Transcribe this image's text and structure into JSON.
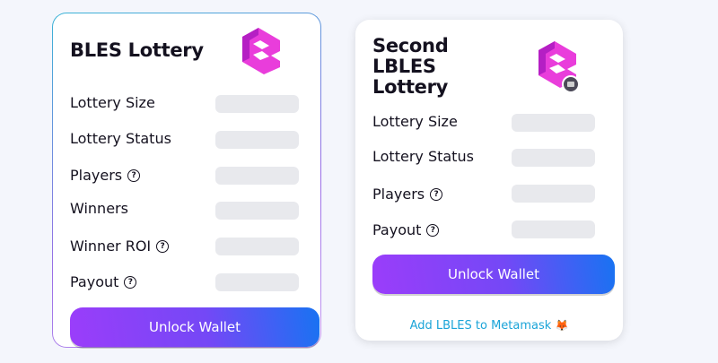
{
  "card1": {
    "title": "BLES Lottery",
    "rows": [
      {
        "label": "Lottery Size",
        "help": false
      },
      {
        "label": "Lottery Status",
        "help": false
      },
      {
        "label": "Players",
        "help": true
      },
      {
        "label": "Winners",
        "help": false
      },
      {
        "label": "Winner ROI",
        "help": true
      },
      {
        "label": "Payout",
        "help": true
      }
    ],
    "button_label": "Unlock Wallet"
  },
  "card2": {
    "title_lines": [
      "Second",
      "LBLES",
      "Lottery"
    ],
    "rows": [
      {
        "label": "Lottery Size",
        "help": false
      },
      {
        "label": "Lottery Status",
        "help": false
      },
      {
        "label": "Players",
        "help": true
      },
      {
        "label": "Payout",
        "help": true
      }
    ],
    "button_label": "Unlock Wallet",
    "metamask_link": "Add LBLES to Metamask",
    "metamask_emoji": "🦊"
  },
  "icons": {
    "help": "?",
    "logo_color": "#e93ddb",
    "logo_dark": "#b51fc4"
  }
}
